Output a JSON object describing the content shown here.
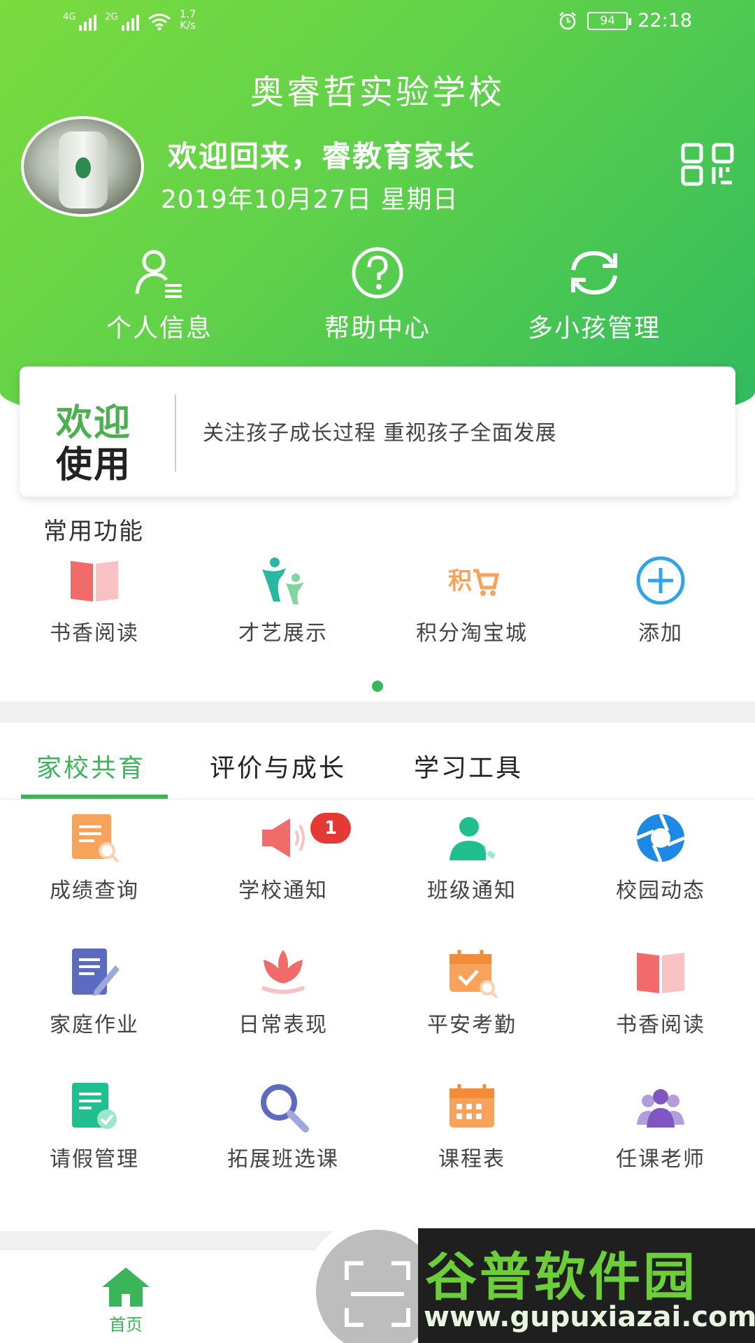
{
  "status_bar": {
    "signal1": "4G",
    "signal2": "2G",
    "speed_value": "1.7",
    "speed_unit": "K/s",
    "battery": "94",
    "time": "22:18"
  },
  "header": {
    "school_name": "奥睿哲实验学校",
    "welcome": "欢迎回来，睿教育家长",
    "date": "2019年10月27日 星期日"
  },
  "quick_actions": [
    {
      "label": "个人信息",
      "icon": "person-list-icon"
    },
    {
      "label": "帮助中心",
      "icon": "question-circle-icon"
    },
    {
      "label": "多小孩管理",
      "icon": "refresh-icon"
    }
  ],
  "banner": {
    "title_line1": "欢迎",
    "title_line2": "使用",
    "slogan": "关注孩子成长过程  重视孩子全面发展"
  },
  "common": {
    "title": "常用功能",
    "items": [
      {
        "label": "书香阅读",
        "icon": "book-icon"
      },
      {
        "label": "才艺展示",
        "icon": "talent-icon"
      },
      {
        "label": "积分淘宝城",
        "icon": "points-cart-icon"
      },
      {
        "label": "添加",
        "icon": "add-circle-icon"
      }
    ]
  },
  "tabs": [
    {
      "label": "家校共育",
      "active": true
    },
    {
      "label": "评价与成长",
      "active": false
    },
    {
      "label": "学习工具",
      "active": false
    }
  ],
  "features": [
    {
      "label": "成绩查询",
      "icon": "report-search-icon"
    },
    {
      "label": "学校通知",
      "icon": "megaphone-icon",
      "badge": "1"
    },
    {
      "label": "班级通知",
      "icon": "contact-phone-icon"
    },
    {
      "label": "校园动态",
      "icon": "aperture-icon"
    },
    {
      "label": "家庭作业",
      "icon": "homework-pen-icon"
    },
    {
      "label": "日常表现",
      "icon": "lotus-icon"
    },
    {
      "label": "平安考勤",
      "icon": "calendar-check-icon"
    },
    {
      "label": "书香阅读",
      "icon": "book-icon"
    },
    {
      "label": "请假管理",
      "icon": "leave-form-icon"
    },
    {
      "label": "拓展班选课",
      "icon": "magnifier-icon"
    },
    {
      "label": "课程表",
      "icon": "timetable-icon"
    },
    {
      "label": "任课老师",
      "icon": "teachers-icon"
    }
  ],
  "bottom_nav": {
    "home_label": "首页"
  },
  "watermark": {
    "brand": "谷普软件园",
    "url": "www.gupuxiazai.com"
  },
  "colors": {
    "primary_green": "#3bb55a",
    "header_gradient_start": "#7bdb3f",
    "header_gradient_end": "#2fba5f",
    "badge_red": "#e53935"
  }
}
